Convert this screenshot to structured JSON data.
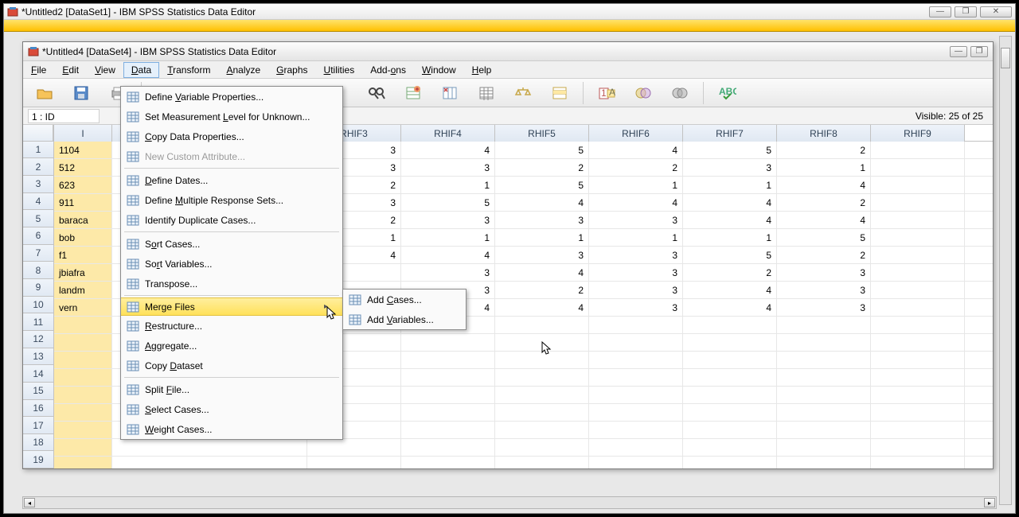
{
  "outer": {
    "title": "*Untitled2 [DataSet1] - IBM SPSS Statistics Data Editor"
  },
  "inner": {
    "title": "*Untitled4 [DataSet4] - IBM SPSS Statistics Data Editor"
  },
  "menubar": [
    "File",
    "Edit",
    "View",
    "Data",
    "Transform",
    "Analyze",
    "Graphs",
    "Utilities",
    "Add-ons",
    "Window",
    "Help"
  ],
  "active_menu_index": 3,
  "infobar": {
    "cell_ref": "1 : ID",
    "visible": "Visible: 25 of 25"
  },
  "columns": [
    "I",
    "RHIF3",
    "RHIF4",
    "RHIF5",
    "RHIF6",
    "RHIF7",
    "RHIF8",
    "RHIF9"
  ],
  "rows": [
    {
      "n": 1,
      "id": "1104",
      "v": [
        3,
        4,
        5,
        4,
        5,
        2,
        null
      ]
    },
    {
      "n": 2,
      "id": "512",
      "v": [
        3,
        3,
        2,
        2,
        3,
        1,
        null
      ]
    },
    {
      "n": 3,
      "id": "623",
      "v": [
        2,
        1,
        5,
        1,
        1,
        4,
        null
      ]
    },
    {
      "n": 4,
      "id": "911",
      "v": [
        3,
        5,
        4,
        4,
        4,
        2,
        null
      ]
    },
    {
      "n": 5,
      "id": "baraca",
      "v": [
        2,
        3,
        3,
        3,
        4,
        4,
        null
      ]
    },
    {
      "n": 6,
      "id": "bob",
      "v": [
        1,
        1,
        1,
        1,
        1,
        5,
        null
      ]
    },
    {
      "n": 7,
      "id": "f1",
      "v": [
        4,
        4,
        3,
        3,
        5,
        2,
        null
      ]
    },
    {
      "n": 8,
      "id": "jbiafra",
      "v": [
        null,
        3,
        4,
        3,
        2,
        3,
        null
      ]
    },
    {
      "n": 9,
      "id": "landm",
      "v": [
        null,
        3,
        2,
        3,
        4,
        3,
        null
      ]
    },
    {
      "n": 10,
      "id": "vern",
      "v": [
        null,
        4,
        4,
        3,
        4,
        3,
        null
      ]
    }
  ],
  "empty_rows_from": 11,
  "empty_rows_to": 19,
  "data_menu": {
    "items": [
      {
        "label": "Define Variable Properties...",
        "icon": "properties-icon"
      },
      {
        "label": "Set Measurement Level for Unknown...",
        "icon": "level-icon"
      },
      {
        "label": "Copy Data Properties...",
        "icon": "copy-props-icon"
      },
      {
        "label": "New Custom Attribute...",
        "icon": "attr-icon",
        "disabled": true
      },
      {
        "label": "Define Dates...",
        "icon": "dates-icon"
      },
      {
        "label": "Define Multiple Response Sets...",
        "icon": "mrs-icon"
      },
      {
        "label": "Identify Duplicate Cases...",
        "icon": "dup-icon"
      },
      {
        "label": "Sort Cases...",
        "icon": "sort-cases-icon"
      },
      {
        "label": "Sort Variables...",
        "icon": "sort-vars-icon"
      },
      {
        "label": "Transpose...",
        "icon": "transpose-icon"
      },
      {
        "label": "Merge Files",
        "icon": "merge-icon",
        "submenu": true,
        "highlight": true
      },
      {
        "label": "Restructure...",
        "icon": "restructure-icon"
      },
      {
        "label": "Aggregate...",
        "icon": "aggregate-icon"
      },
      {
        "label": "Copy Dataset",
        "icon": "copy-ds-icon"
      },
      {
        "label": "Split File...",
        "icon": "split-icon"
      },
      {
        "label": "Select Cases...",
        "icon": "select-icon"
      },
      {
        "label": "Weight Cases...",
        "icon": "weight-icon"
      }
    ],
    "separators_after": [
      3,
      6,
      9,
      13
    ]
  },
  "merge_submenu": {
    "items": [
      {
        "label": "Add Cases...",
        "icon": "add-cases-icon"
      },
      {
        "label": "Add Variables...",
        "icon": "add-vars-icon"
      }
    ]
  },
  "underline_chars": {
    "menubar": [
      "F",
      "E",
      "V",
      "D",
      "T",
      "A",
      "G",
      "U",
      "o",
      "W",
      "H"
    ],
    "data_menu": [
      "V",
      "L",
      "C",
      "",
      "D",
      "M",
      "U",
      "o",
      "r",
      "N",
      "g",
      "R",
      "A",
      "D",
      "F",
      "S",
      "W"
    ],
    "merge_submenu": [
      "C",
      "V"
    ]
  }
}
